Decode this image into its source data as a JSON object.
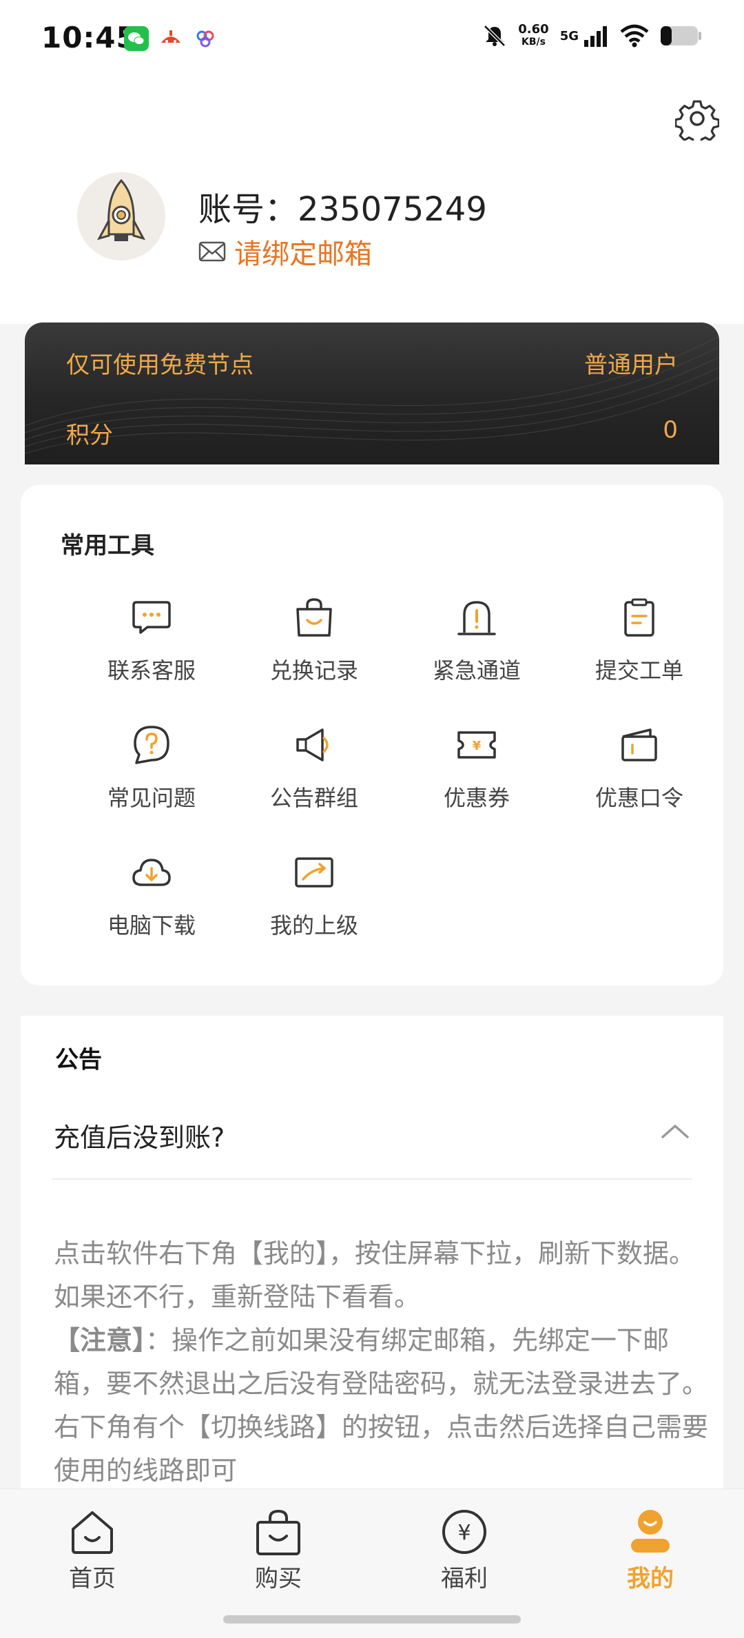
{
  "status_bar": {
    "time": "10:45",
    "net_speed_value": "0.60",
    "net_speed_unit": "KB/s",
    "network": "5G",
    "icons": [
      "wechat-icon",
      "app-icon",
      "baidu-icon",
      "mute-icon",
      "signal-icon",
      "wifi-icon",
      "battery-icon"
    ]
  },
  "profile": {
    "account_label": "账号：235075249",
    "email_prompt": "请绑定邮箱"
  },
  "member_card": {
    "node_info": "仅可使用免费节点",
    "user_level": "普通用户",
    "points_label": "积分",
    "points_value": "0"
  },
  "tools": {
    "title": "常用工具",
    "items": [
      {
        "label": "联系客服",
        "icon": "chat-icon"
      },
      {
        "label": "兑换记录",
        "icon": "shopping-bag-icon"
      },
      {
        "label": "紧急通道",
        "icon": "alert-icon"
      },
      {
        "label": "提交工单",
        "icon": "clipboard-icon"
      },
      {
        "label": "常见问题",
        "icon": "question-icon"
      },
      {
        "label": "公告群组",
        "icon": "megaphone-icon"
      },
      {
        "label": "优惠券",
        "icon": "coupon-icon"
      },
      {
        "label": "优惠口令",
        "icon": "wallet-icon"
      },
      {
        "label": "电脑下载",
        "icon": "cloud-download-icon"
      },
      {
        "label": "我的上级",
        "icon": "share-icon"
      }
    ]
  },
  "notice": {
    "title": "公告",
    "faq_question": "充值后没到账?",
    "faq_answer_1": "点击软件右下角【我的】，按住屏幕下拉，刷新下数据。 如果还不行，重新登陆下看看。",
    "faq_answer_note": "【注意】",
    "faq_answer_2": "：操作之前如果没有绑定邮箱，先绑定一下邮箱，要不然退出之后没有登陆密码，就无法登录进去了。右下角有个【切换线路】的按钮，点击然后选择自己需要使用的线路即可"
  },
  "tabbar": {
    "tabs": [
      {
        "label": "首页",
        "icon": "home-icon"
      },
      {
        "label": "购买",
        "icon": "bag-icon"
      },
      {
        "label": "福利",
        "icon": "yen-icon"
      },
      {
        "label": "我的",
        "icon": "user-icon"
      }
    ]
  },
  "colors": {
    "accent": "#f0a22e",
    "email_orange": "#e9741f",
    "card_text": "#f0a94a"
  }
}
